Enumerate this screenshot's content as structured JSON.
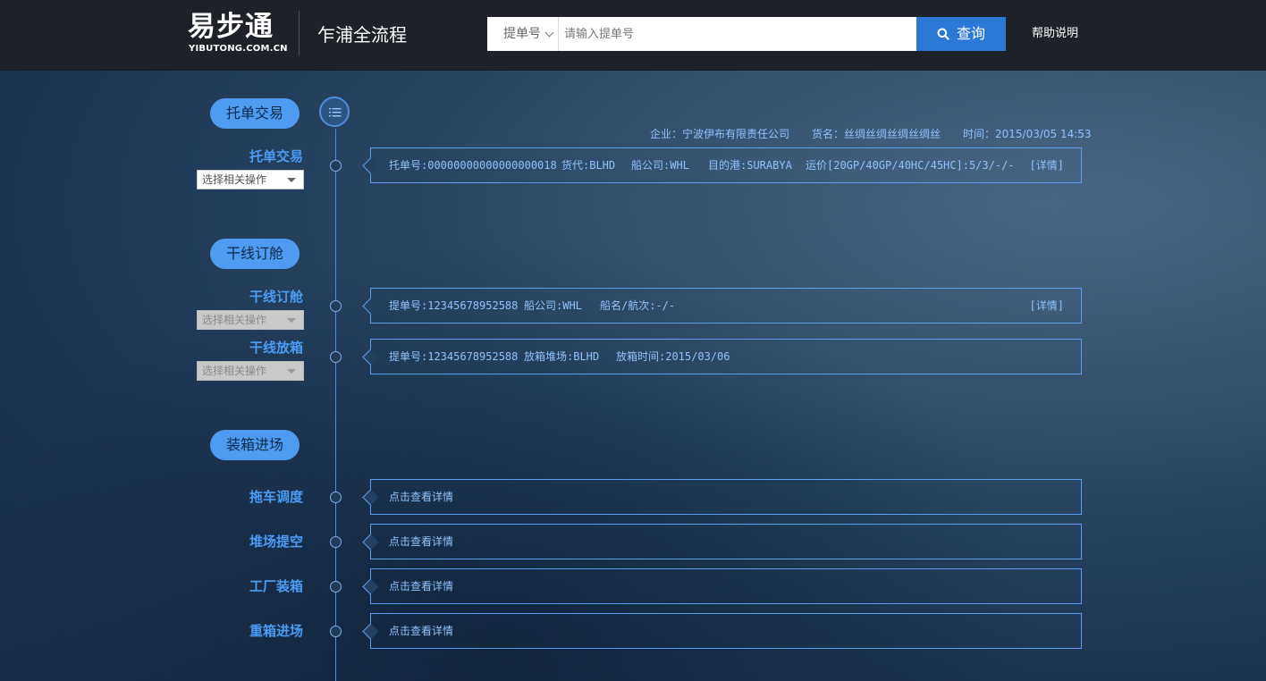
{
  "header": {
    "logo_cn": "易步通",
    "logo_en": "YIBUTONG.COM.CN",
    "app_title": "乍浦全流程",
    "search": {
      "type_selected": "提单号",
      "placeholder": "请输入提单号",
      "button_label": "查询"
    },
    "help_label": "帮助说明"
  },
  "meta": {
    "company": "企业：宁波伊布有限责任公司",
    "goods": "货名：丝绸丝绸丝绸丝绸丝",
    "time": "时间：2015/03/05 14:53"
  },
  "stages": [
    {
      "label": "托单交易"
    },
    {
      "label": "干线订舱"
    },
    {
      "label": "装箱进场"
    }
  ],
  "steps": [
    {
      "label": "托单交易",
      "select": "选择相关操作",
      "fields": [
        "托单号:00000000000000000018",
        "货代:BLHD",
        "船公司:WHL",
        "目的港:SURABYA",
        "运价[20GP/40GP/40HC/45HC]:5/3/-/-"
      ],
      "detail": "[详情]"
    },
    {
      "label": "干线订舱",
      "select": "选择相关操作",
      "fields": [
        "提单号:12345678952588",
        "船公司:WHL",
        "船名/航次:-/-"
      ],
      "detail": "[详情]"
    },
    {
      "label": "干线放箱",
      "select": "选择相关操作",
      "fields": [
        "提单号:12345678952588",
        "放箱堆场:BLHD",
        "放箱时间:2015/03/06"
      ]
    },
    {
      "label": "拖车调度",
      "link": "点击查看详情"
    },
    {
      "label": "堆场提空",
      "link": "点击查看详情"
    },
    {
      "label": "工厂装箱",
      "link": "点击查看详情"
    },
    {
      "label": "重箱进场",
      "link": "点击查看详情"
    }
  ],
  "colors": {
    "accent": "#2b78d6",
    "pill": "#4e9bef",
    "step_label": "#4a9cf5",
    "card_text": "#8fc3ff",
    "card_border": "#5b9ff0",
    "topbar": "#1e2228"
  },
  "icons": [
    "search-icon",
    "list-icon",
    "dropdown-arrow-icon"
  ]
}
